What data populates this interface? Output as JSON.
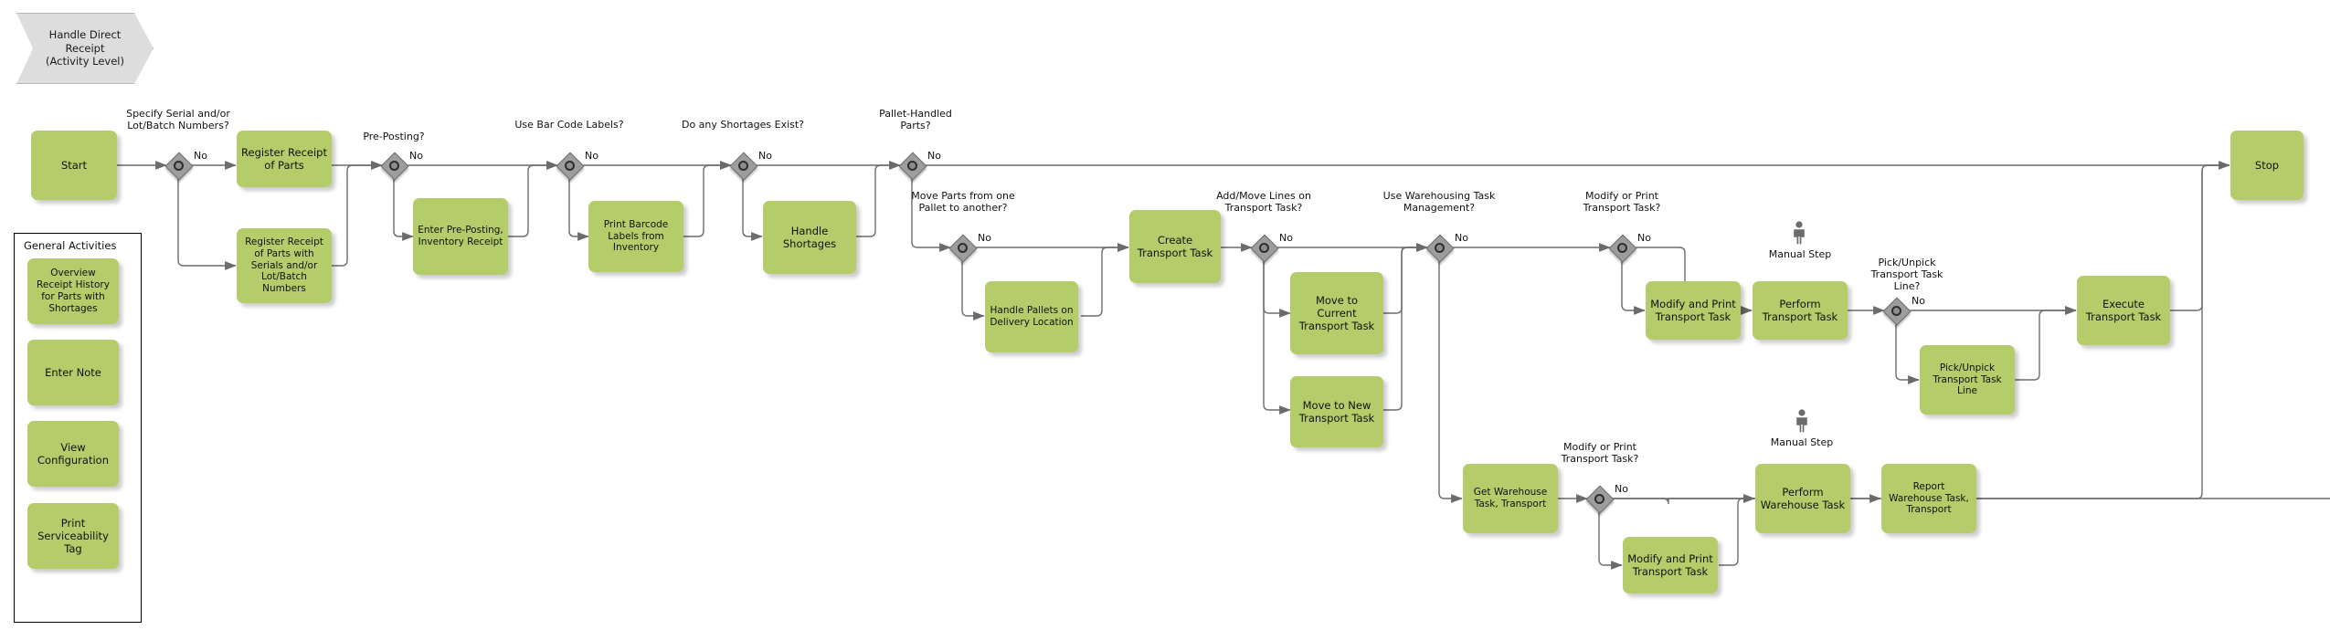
{
  "title": {
    "line1": "Handle Direct",
    "line2": "Receipt",
    "line3": "(Activity Level)",
    "full": "Handle Direct Receipt (Activity Level)"
  },
  "colors": {
    "activity_fill": "#b5cc6a",
    "gateway_fill": "#9d9d9d",
    "banner_fill": "#dddddd",
    "connector": "#6b6b6b",
    "text": "#111111"
  },
  "branch_label": "No",
  "manual_step_label": "Manual Step",
  "general_activities": {
    "title": "General Activities",
    "items": [
      {
        "label": "Overview Receipt History for Parts with Shortages"
      },
      {
        "label": "Enter Note"
      },
      {
        "label": "View Configuration"
      },
      {
        "label": "Print Serviceability Tag"
      }
    ]
  },
  "terminals": {
    "start": "Start",
    "stop": "Stop"
  },
  "gateways": [
    {
      "id": "g1",
      "label": "Specify Serial and/or Lot/Batch Numbers?",
      "no_label": "No"
    },
    {
      "id": "g2",
      "label": "Pre-Posting?",
      "no_label": "No"
    },
    {
      "id": "g3",
      "label": "Use Bar Code Labels?",
      "no_label": "No"
    },
    {
      "id": "g4",
      "label": "Do any Shortages Exist?",
      "no_label": "No"
    },
    {
      "id": "g5",
      "label": "Pallet-Handled Parts?",
      "no_label": "No"
    },
    {
      "id": "g6",
      "label": "Move Parts from one Pallet to another?",
      "no_label": "No"
    },
    {
      "id": "g7",
      "label": "Add/Move Lines on Transport Task?",
      "no_label": "No"
    },
    {
      "id": "g8",
      "label": "Use Warehousing Task Management?",
      "no_label": "No"
    },
    {
      "id": "g9",
      "label": "Modify or Print Transport Task?",
      "no_label": "No"
    },
    {
      "id": "g10",
      "label": "Pick/Unpick Transport Task Line?",
      "no_label": "No"
    },
    {
      "id": "g11",
      "label": "Modify or Print Transport Task?",
      "no_label": "No"
    }
  ],
  "activities": [
    {
      "id": "a1",
      "label": "Register Receipt of Parts"
    },
    {
      "id": "a2",
      "label": "Register Receipt of Parts with Serials and/or Lot/Batch Numbers"
    },
    {
      "id": "a3",
      "label": "Enter Pre-Posting, Inventory Receipt"
    },
    {
      "id": "a4",
      "label": "Print Barcode Labels from Inventory"
    },
    {
      "id": "a5",
      "label": "Handle Shortages"
    },
    {
      "id": "a6",
      "label": "Handle Pallets on Delivery Location"
    },
    {
      "id": "a7",
      "label": "Create Transport Task"
    },
    {
      "id": "a8",
      "label": "Move to Current Transport Task"
    },
    {
      "id": "a9",
      "label": "Move to New Transport Task"
    },
    {
      "id": "a10",
      "label": "Modify and Print Transport Task"
    },
    {
      "id": "a11",
      "label": "Perform Transport Task",
      "manual": true
    },
    {
      "id": "a12",
      "label": "Pick/Unpick Transport Task Line"
    },
    {
      "id": "a13",
      "label": "Execute Transport Task"
    },
    {
      "id": "a14",
      "label": "Get Warehouse Task, Transport"
    },
    {
      "id": "a15",
      "label": "Modify and Print Transport Task"
    },
    {
      "id": "a16",
      "label": "Perform Warehouse Task",
      "manual": true
    },
    {
      "id": "a17",
      "label": "Report Warehouse Task, Transport"
    }
  ]
}
